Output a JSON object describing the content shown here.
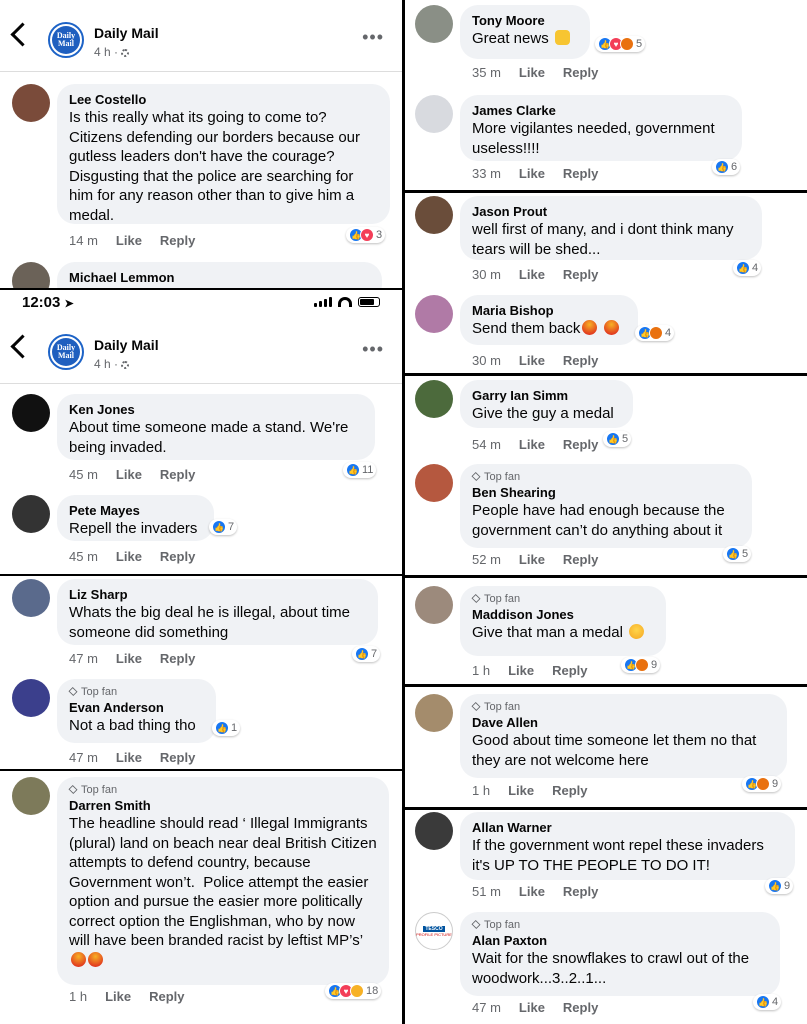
{
  "page": {
    "name": "Daily Mail",
    "time": "4 h ·",
    "logo_top": "Daily",
    "logo_bottom": "Mail",
    "more": "•••"
  },
  "statusbar": {
    "time": "12:03"
  },
  "icons": {
    "back": "chevron-left-icon",
    "settings": "gear-icon",
    "more": "more-icon",
    "location": "location-arrow-icon",
    "like": "like-icon",
    "love": "love-icon",
    "angry": "angry-icon",
    "haha": "haha-icon",
    "top_fan": "diamond-icon"
  },
  "labels": {
    "like": "Like",
    "reply": "Reply",
    "top_fan": "Top fan"
  },
  "colors": {
    "like": "#1877f2",
    "love": "#f33e58",
    "angry": "#e9710f",
    "haha": "#f7b125",
    "bubble": "#f0f2f5"
  },
  "comments": {
    "lee": {
      "name": "Lee Costello",
      "text": "Is this really what its going to come to? Citizens defending our borders because our gutless leaders don't have the courage? Disgusting that the police are searching for him for any reason other than to give him a medal.",
      "time": "14 m",
      "reactions": "3"
    },
    "michael": {
      "name": "Michael Lemmon"
    },
    "ken": {
      "name": "Ken Jones",
      "text": "About time someone made a stand. We're being invaded.",
      "time": "45 m",
      "reactions": "11"
    },
    "pete": {
      "name": "Pete Mayes",
      "text": "Repell the invaders",
      "time": "45 m",
      "reactions": "7"
    },
    "liz": {
      "name": "Liz Sharp",
      "text": "Whats the big deal he is illegal, about time someone did something",
      "time": "47 m",
      "reactions": "7"
    },
    "evan": {
      "name": "Evan Anderson",
      "text": "Not a bad thing tho",
      "time": "47 m",
      "reactions": "1"
    },
    "darren": {
      "name": "Darren Smith",
      "text": "The headline should read ‘ Illegal Immigrants (plural) land on beach near deal British Citizen attempts to defend country, because Government won’t.  Police attempt the easier option and pursue the easier more politically correct option the Englishman, who by now will have been branded racist by leftist MP’s’",
      "time": "1 h",
      "reactions": "18"
    },
    "tony": {
      "name": "Tony Moore",
      "text": "Great news",
      "time": "35 m",
      "reactions": "5"
    },
    "james": {
      "name": "James Clarke",
      "text": "More vigilantes needed, government useless!!!!",
      "time": "33 m",
      "reactions": "6"
    },
    "jason": {
      "name": "Jason Prout",
      "text": "well first of many, and i dont think many tears will be shed...",
      "time": "30 m",
      "reactions": "4"
    },
    "maria": {
      "name": "Maria Bishop",
      "text": "Send them back",
      "time": "30 m",
      "reactions": "4"
    },
    "garry": {
      "name": "Garry Ian Simm",
      "text": "Give the guy a medal",
      "time": "54 m",
      "reactions": "5"
    },
    "ben": {
      "name": "Ben Shearing",
      "text": "People have had enough because the government can’t do anything about it",
      "time": "52 m",
      "reactions": "5"
    },
    "madison": {
      "name": "Maddison Jones",
      "text": "Give that man a medal",
      "time": "1 h",
      "reactions": "9"
    },
    "dave": {
      "name": "Dave Allen",
      "text": "Good about time someone let them no that they are not welcome here",
      "time": "1 h",
      "reactions": "9"
    },
    "allan": {
      "name": "Allan Warner",
      "text": "If the government wont repel these invaders it's UP TO THE PEOPLE TO DO IT!",
      "time": "51 m",
      "reactions": "9"
    },
    "alan": {
      "name": "Alan Paxton",
      "text": "Wait for the snowflakes to crawl out of the woodwork...3..2..1...",
      "time": "47 m",
      "reactions": "4",
      "avatar_text_1": "TESCO",
      "avatar_text_2": "PROFILE PICTURE"
    }
  }
}
